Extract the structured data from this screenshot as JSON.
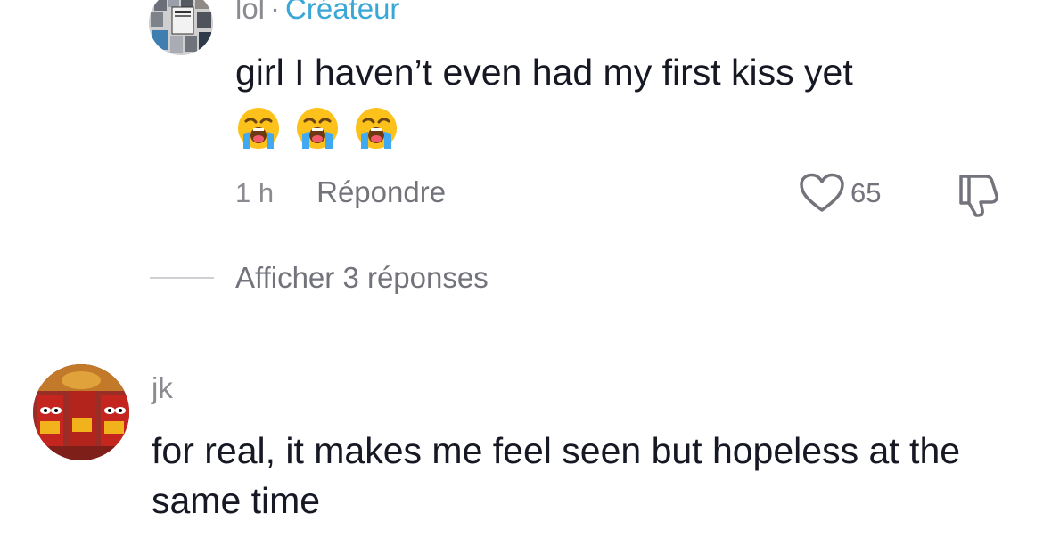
{
  "reply": {
    "username": "lol",
    "separator": "·",
    "creator_badge": "Créateur",
    "text": "girl I haven’t even had my first kiss yet",
    "emojis": [
      "loudly-crying-face",
      "loudly-crying-face",
      "loudly-crying-face"
    ],
    "time": "1 h",
    "reply_label": "Répondre",
    "like_count": "65",
    "view_replies_label": "Afficher 3 réponses"
  },
  "comment": {
    "username": "jk",
    "text": "for real, it makes me feel seen but hopeless at the same time"
  },
  "icons": {
    "like": "heart-outline-icon",
    "dislike": "thumbs-down-icon"
  },
  "colors": {
    "creator": "#3aa7d6",
    "secondary_text": "#8a8b91",
    "primary_text": "#161823"
  }
}
